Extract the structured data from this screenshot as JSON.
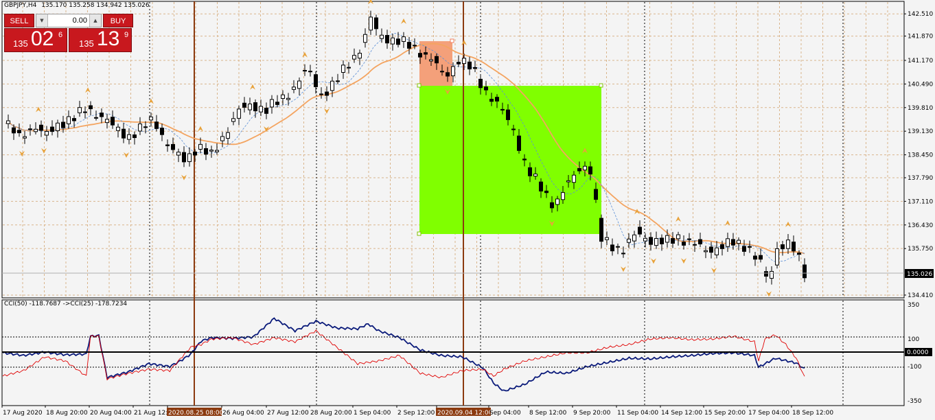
{
  "symbol_header": {
    "symbol": "GBPJPY,H4",
    "ohlc": "135.170 135.258 134.942 135.026"
  },
  "trade_panel": {
    "sell_label": "SELL",
    "buy_label": "BUY",
    "lot_value": "0.00",
    "sell_price": {
      "prefix": "135",
      "big": "02",
      "sup": "6"
    },
    "buy_price": {
      "prefix": "135",
      "big": "13",
      "sup": "9"
    }
  },
  "indicator_header": {
    "text": "CCI(50) -118.7687  ->CCI(25) -178.7234"
  },
  "colors": {
    "background": "#f4f4f4",
    "grid": "#d9b48a",
    "bull_candle": "#ffffff",
    "bear_candle": "#000000",
    "ma_slow": "#f4a460",
    "ma_fast": "#5b8fd6",
    "green_box": "#80ff00",
    "orange_box": "#f4a07a",
    "vline": "#8b3a0f",
    "cci50": "#0a1a7a",
    "cci25": "#e00000",
    "fractal": "#e8a23a",
    "price_tag": "#000000"
  },
  "chart_data": [
    {
      "type": "candlestick",
      "title": "GBPJPY,H4",
      "y_ticks": [
        "142.510",
        "141.870",
        "141.170",
        "140.490",
        "139.810",
        "139.130",
        "138.450",
        "137.790",
        "137.110",
        "136.430",
        "135.750",
        "134.410"
      ],
      "ylim": [
        134.35,
        142.85
      ],
      "current_price": "135.026",
      "x_tick_labels": [
        "17 Aug 2020",
        "18 Aug 20:00",
        "20 Aug 04:00",
        "21 Aug 12:00",
        "2020.08.25 08:00",
        "26 Aug 04:00",
        "27 Aug 12:00",
        "28 Aug 20:00",
        "1 Sep 04:00",
        "2 Sep 12:00",
        "2020.09.04 12:00",
        "Sep 04:00",
        "8 Sep 12:00",
        "9 Sep 20:00",
        "11 Sep 04:00",
        "14 Sep 12:00",
        "15 Sep 20:00",
        "17 Sep 04:00",
        "18 Sep 12:00"
      ],
      "highlighted_time_labels": [
        "2020.08.25 08:00",
        "2020.09.04 12:00"
      ],
      "anchors": [
        [
          0,
          139.35
        ],
        [
          5,
          138.95
        ],
        [
          10,
          139.3
        ],
        [
          15,
          139.0
        ],
        [
          20,
          139.4
        ],
        [
          25,
          139.5
        ],
        [
          30,
          139.8
        ],
        [
          35,
          139.55
        ],
        [
          40,
          139.2
        ],
        [
          45,
          139.0
        ],
        [
          50,
          139.2
        ],
        [
          54,
          139.5
        ],
        [
          60,
          138.6
        ],
        [
          65,
          138.3
        ],
        [
          70,
          138.7
        ],
        [
          75,
          138.4
        ],
        [
          80,
          139.1
        ],
        [
          85,
          139.7
        ],
        [
          90,
          139.9
        ],
        [
          95,
          139.75
        ],
        [
          100,
          140.0
        ],
        [
          105,
          140.4
        ],
        [
          110,
          140.9
        ],
        [
          115,
          140.2
        ],
        [
          120,
          140.5
        ],
        [
          125,
          141.1
        ],
        [
          130,
          141.6
        ],
        [
          133,
          142.35
        ],
        [
          136,
          141.9
        ],
        [
          140,
          141.8
        ],
        [
          145,
          141.65
        ],
        [
          150,
          141.5
        ],
        [
          155,
          141.2
        ],
        [
          160,
          140.7
        ],
        [
          165,
          141.2
        ],
        [
          170,
          140.9
        ],
        [
          175,
          140.3
        ],
        [
          180,
          139.8
        ],
        [
          185,
          139.2
        ],
        [
          190,
          138.0
        ],
        [
          195,
          137.5
        ],
        [
          200,
          137.0
        ],
        [
          205,
          137.6
        ],
        [
          210,
          138.2
        ],
        [
          213,
          138.0
        ],
        [
          217,
          136.0
        ],
        [
          220,
          135.9
        ],
        [
          225,
          135.7
        ],
        [
          230,
          136.2
        ],
        [
          235,
          136.0
        ],
        [
          240,
          135.9
        ],
        [
          245,
          136.1
        ],
        [
          250,
          135.9
        ],
        [
          255,
          135.7
        ],
        [
          260,
          135.8
        ],
        [
          265,
          135.9
        ],
        [
          270,
          135.85
        ],
        [
          275,
          135.3
        ],
        [
          278,
          134.75
        ],
        [
          281,
          135.8
        ],
        [
          285,
          135.9
        ],
        [
          288,
          135.6
        ],
        [
          291,
          135.05
        ]
      ],
      "n_candles": 292
    },
    {
      "type": "line",
      "title": "CCI(50) -118.7687 ->CCI(25) -178.7234",
      "y_ticks": [
        "350",
        "100",
        "0.0000",
        "-100",
        "-350"
      ],
      "ylim": [
        -380,
        380
      ],
      "series": [
        {
          "name": "CCI(50)",
          "anchors": [
            [
              0,
              0
            ],
            [
              10,
              -20
            ],
            [
              20,
              5
            ],
            [
              30,
              -15
            ],
            [
              40,
              -10
            ],
            [
              42,
              120
            ],
            [
              46,
              125
            ],
            [
              50,
              -180
            ],
            [
              60,
              -140
            ],
            [
              70,
              -80
            ],
            [
              80,
              -100
            ],
            [
              85,
              -60
            ],
            [
              90,
              -10
            ],
            [
              95,
              85
            ],
            [
              100,
              110
            ],
            [
              110,
              105
            ],
            [
              120,
              115
            ],
            [
              130,
              250
            ],
            [
              140,
              160
            ],
            [
              150,
              230
            ],
            [
              160,
              180
            ],
            [
              170,
              175
            ],
            [
              175,
              210
            ],
            [
              180,
              160
            ],
            [
              190,
              110
            ],
            [
              200,
              20
            ],
            [
              210,
              -20
            ],
            [
              220,
              -30
            ],
            [
              230,
              -110
            ],
            [
              235,
              -220
            ],
            [
              240,
              -280
            ],
            [
              250,
              -230
            ],
            [
              260,
              -140
            ],
            [
              270,
              -150
            ],
            [
              280,
              -100
            ],
            [
              290,
              -70
            ],
            [
              300,
              -40
            ],
            [
              310,
              -45
            ],
            [
              320,
              -30
            ],
            [
              330,
              -20
            ],
            [
              340,
              -5
            ],
            [
              350,
              0
            ],
            [
              360,
              -20
            ],
            [
              362,
              -105
            ],
            [
              370,
              -40
            ],
            [
              380,
              -75
            ],
            [
              384,
              -118
            ]
          ]
        },
        {
          "name": "CCI(25)",
          "anchors": [
            [
              0,
              -170
            ],
            [
              10,
              -130
            ],
            [
              20,
              -30
            ],
            [
              30,
              -60
            ],
            [
              40,
              -170
            ],
            [
              42,
              120
            ],
            [
              46,
              120
            ],
            [
              50,
              -190
            ],
            [
              60,
              -150
            ],
            [
              70,
              -120
            ],
            [
              80,
              -130
            ],
            [
              90,
              40
            ],
            [
              95,
              60
            ],
            [
              100,
              100
            ],
            [
              110,
              110
            ],
            [
              120,
              60
            ],
            [
              130,
              110
            ],
            [
              140,
              80
            ],
            [
              150,
              160
            ],
            [
              160,
              40
            ],
            [
              170,
              -80
            ],
            [
              180,
              -60
            ],
            [
              190,
              -20
            ],
            [
              200,
              -150
            ],
            [
              210,
              -180
            ],
            [
              220,
              -130
            ],
            [
              230,
              -120
            ],
            [
              235,
              -170
            ],
            [
              240,
              -120
            ],
            [
              250,
              -60
            ],
            [
              260,
              -30
            ],
            [
              270,
              0
            ],
            [
              280,
              0
            ],
            [
              290,
              40
            ],
            [
              300,
              60
            ],
            [
              310,
              100
            ],
            [
              320,
              110
            ],
            [
              330,
              95
            ],
            [
              340,
              100
            ],
            [
              350,
              120
            ],
            [
              360,
              80
            ],
            [
              362,
              -60
            ],
            [
              365,
              100
            ],
            [
              370,
              130
            ],
            [
              375,
              60
            ],
            [
              380,
              -40
            ],
            [
              384,
              -178
            ]
          ]
        }
      ]
    }
  ]
}
